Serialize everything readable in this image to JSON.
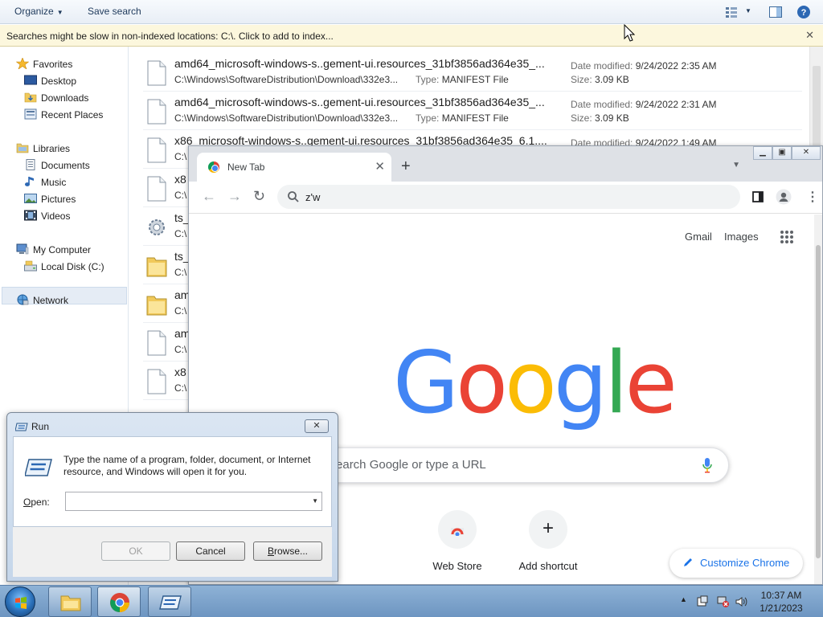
{
  "explorer": {
    "toolbar": {
      "organize": "Organize",
      "save_search": "Save search"
    },
    "infobar": "Searches might be slow in non-indexed locations: C:\\. Click to add to index...",
    "nav": {
      "favorites": "Favorites",
      "desktop": "Desktop",
      "downloads": "Downloads",
      "recent_places": "Recent Places",
      "libraries": "Libraries",
      "documents": "Documents",
      "music": "Music",
      "pictures": "Pictures",
      "videos": "Videos",
      "my_computer": "My Computer",
      "local_disk": "Local Disk (C:)",
      "network": "Network"
    },
    "labels": {
      "date_modified": "Date modified:",
      "type": "Type:",
      "size": "Size:"
    },
    "files": [
      {
        "name": "amd64_microsoft-windows-s..gement-ui.resources_31bf3856ad364e35_...",
        "path": "C:\\Windows\\SoftwareDistribution\\Download\\332e3...",
        "type": "MANIFEST File",
        "date": "9/24/2022 2:35 AM",
        "size": "3.09 KB"
      },
      {
        "name": "amd64_microsoft-windows-s..gement-ui.resources_31bf3856ad364e35_...",
        "path": "C:\\Windows\\SoftwareDistribution\\Download\\332e3...",
        "type": "MANIFEST File",
        "date": "9/24/2022 2:31 AM",
        "size": "3.09 KB"
      },
      {
        "name": "x86_microsoft-windows-s..gement-ui.resources_31bf3856ad364e35_6.1....",
        "path": "C:\\",
        "type": "",
        "date": "9/24/2022 1:49 AM",
        "size": ""
      },
      {
        "name": "x8",
        "path": "C:\\",
        "type": "",
        "date": "",
        "size": ""
      },
      {
        "name": "ts_",
        "path": "C:\\",
        "type": "",
        "date": "",
        "size": ""
      },
      {
        "name": "ts_",
        "path": "C:\\",
        "type": "",
        "date": "",
        "size": ""
      },
      {
        "name": "am",
        "path": "C:\\",
        "type": "",
        "date": "",
        "size": ""
      },
      {
        "name": "am",
        "path": "C:\\",
        "type": "",
        "date": "",
        "size": ""
      },
      {
        "name": "x8",
        "path": "C:\\",
        "type": "",
        "date": "",
        "size": ""
      }
    ]
  },
  "chrome": {
    "tab_title": "New Tab",
    "omnibox_value": "z'w",
    "gmail": "Gmail",
    "images": "Images",
    "search_placeholder": "Search Google or type a URL",
    "shortcuts": [
      "Web Store",
      "Add shortcut"
    ],
    "customize": "Customize Chrome",
    "logo_letters": [
      "G",
      "o",
      "o",
      "g",
      "l",
      "e"
    ],
    "logo_colors": [
      "#4285f4",
      "#ea4335",
      "#fbbc05",
      "#4285f4",
      "#34a853",
      "#ea4335"
    ]
  },
  "run": {
    "title": "Run",
    "description": "Type the name of a program, folder, document, or Internet resource, and Windows will open it for you.",
    "open_label_underlined": "O",
    "open_label_rest": "pen:",
    "open_value": "",
    "ok": "OK",
    "cancel": "Cancel",
    "browse_underlined": "B",
    "browse_rest": "rowse..."
  },
  "taskbar": {
    "time": "10:37 AM",
    "date": "1/21/2023"
  }
}
